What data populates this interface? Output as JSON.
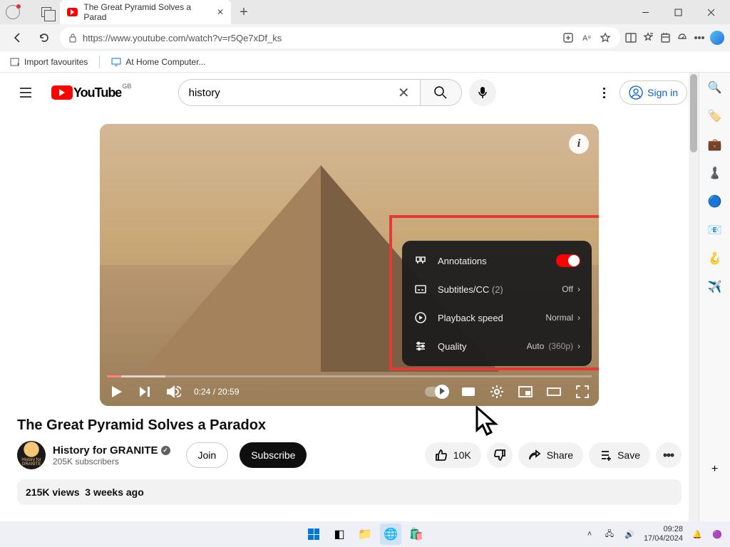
{
  "browser": {
    "tab_title": "The Great Pyramid Solves a Parad",
    "url": "https://www.youtube.com/watch?v=r5Qe7xDf_ks",
    "fav1": "Import favourites",
    "fav2": "At Home Computer..."
  },
  "yt": {
    "logo_text": "YouTube",
    "region": "GB",
    "search_value": "history",
    "signin": "Sign in"
  },
  "player": {
    "time_current": "0:24",
    "time_total": "20:59",
    "menu": {
      "annotations": "Annotations",
      "subtitles": "Subtitles/CC",
      "subtitles_count": "(2)",
      "subtitles_val": "Off",
      "speed": "Playback speed",
      "speed_val": "Normal",
      "quality": "Quality",
      "quality_val": "Auto",
      "quality_detail": "(360p)"
    }
  },
  "video": {
    "title": "The Great Pyramid Solves a Paradox",
    "channel": "History for GRANITE",
    "subs": "205K subscribers",
    "join": "Join",
    "subscribe": "Subscribe",
    "likes": "10K",
    "share": "Share",
    "save": "Save",
    "views": "215K views",
    "age": "3 weeks ago"
  },
  "system": {
    "time": "09:28",
    "date": "17/04/2024"
  }
}
